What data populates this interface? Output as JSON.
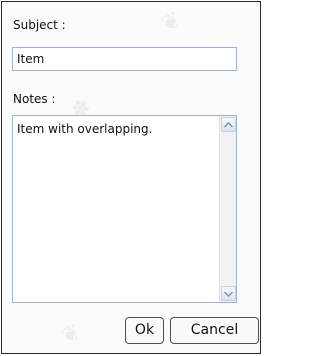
{
  "form": {
    "subject_label": "Subject :",
    "subject_value": "Item",
    "notes_label": "Notes :",
    "notes_value": "Item with overlapping."
  },
  "buttons": {
    "ok_label": "Ok",
    "cancel_label": "Cancel"
  },
  "colors": {
    "field_border": "#9db3d6",
    "panel_border": "#2b2b2b",
    "background": "#fbfbfb"
  },
  "icons": {
    "scroll_up": "chevron-up-icon",
    "scroll_down": "chevron-down-icon"
  }
}
